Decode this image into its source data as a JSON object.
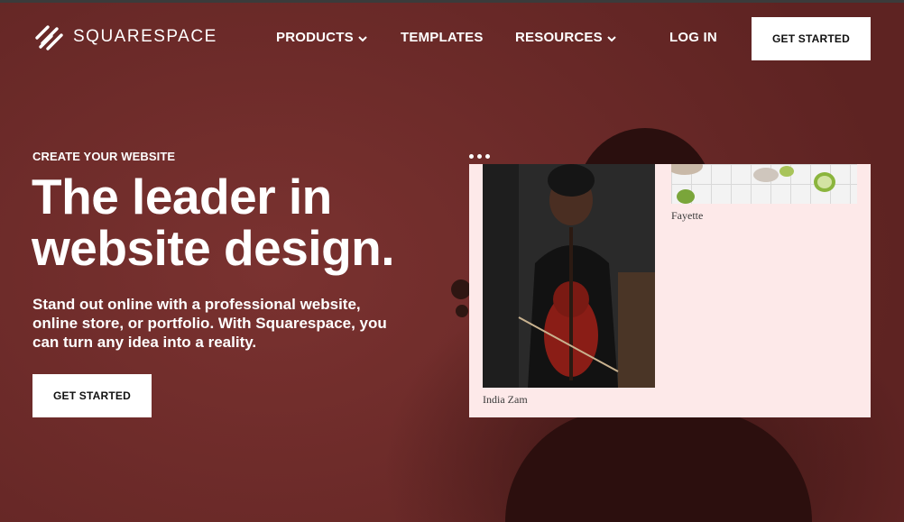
{
  "brand": {
    "name": "SQUARESPACE",
    "logo_icon": "squarespace-logo-icon"
  },
  "nav": {
    "items": [
      {
        "label": "PRODUCTS",
        "has_dropdown": true
      },
      {
        "label": "TEMPLATES",
        "has_dropdown": false
      },
      {
        "label": "RESOURCES",
        "has_dropdown": true
      }
    ],
    "login_label": "LOG IN",
    "cta_label": "GET STARTED"
  },
  "hero": {
    "eyebrow": "CREATE YOUR WEBSITE",
    "headline_line1": "The leader in",
    "headline_line2": "website design.",
    "subtext": "Stand out online with a professional website, online store, or portfolio. With Squarespace, you can turn any idea into a reality.",
    "cta_label": "GET STARTED"
  },
  "preview": {
    "caption_left": "India Zam",
    "caption_right": "Fayette"
  },
  "colors": {
    "background": "#6e2c2b",
    "card": "#fde9e9",
    "button": "#ffffff",
    "button_text": "#111111"
  }
}
